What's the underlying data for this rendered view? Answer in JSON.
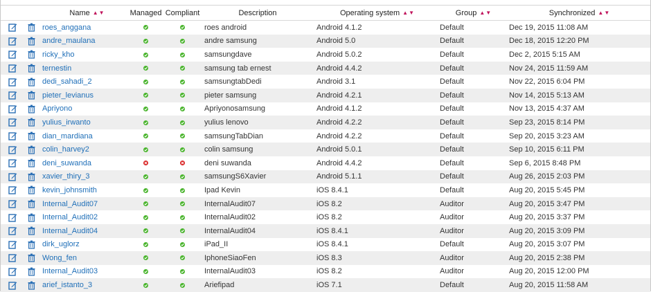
{
  "columns": {
    "name": "Name",
    "managed": "Managed",
    "compliant": "Compliant",
    "description": "Description",
    "os": "Operating system",
    "group": "Group",
    "synchronized": "Synchronized"
  },
  "sort_indicator": "▲▼",
  "colors": {
    "link": "#1f6fb8",
    "sort_arrow": "#c0135b",
    "ok": "#49b42c",
    "bad": "#d92525",
    "icon_blue": "#2a6fb5"
  },
  "icons": {
    "edit": "edit-icon",
    "delete": "trash-icon",
    "ok": "check-circle-icon",
    "bad": "x-circle-icon"
  },
  "rows": [
    {
      "name": "roes_anggana",
      "managed": "ok",
      "compliant": "ok",
      "description": "roes android",
      "os": "Android 4.1.2",
      "group": "Default",
      "synchronized": "Dec 19, 2015 11:08 AM"
    },
    {
      "name": "andre_maulana",
      "managed": "ok",
      "compliant": "ok",
      "description": "andre samsung",
      "os": "Android 5.0",
      "group": "Default",
      "synchronized": "Dec 18, 2015 12:20 PM"
    },
    {
      "name": "ricky_kho",
      "managed": "ok",
      "compliant": "ok",
      "description": "samsungdave",
      "os": "Android 5.0.2",
      "group": "Default",
      "synchronized": "Dec 2, 2015 5:15 AM"
    },
    {
      "name": "ternestin",
      "managed": "ok",
      "compliant": "ok",
      "description": "samsung tab ernest",
      "os": "Android 4.4.2",
      "group": "Default",
      "synchronized": "Nov 24, 2015 11:59 AM"
    },
    {
      "name": "dedi_sahadi_2",
      "managed": "ok",
      "compliant": "ok",
      "description": "samsungtabDedi",
      "os": "Android 3.1",
      "group": "Default",
      "synchronized": "Nov 22, 2015 6:04 PM"
    },
    {
      "name": "pieter_levianus",
      "managed": "ok",
      "compliant": "ok",
      "description": "pieter samsung",
      "os": "Android 4.2.1",
      "group": "Default",
      "synchronized": "Nov 14, 2015 5:13 AM"
    },
    {
      "name": "Apriyono",
      "managed": "ok",
      "compliant": "ok",
      "description": "Apriyonosamsung",
      "os": "Android 4.1.2",
      "group": "Default",
      "synchronized": "Nov 13, 2015 4:37 AM"
    },
    {
      "name": "yulius_irwanto",
      "managed": "ok",
      "compliant": "ok",
      "description": "yulius lenovo",
      "os": "Android 4.2.2",
      "group": "Default",
      "synchronized": "Sep 23, 2015 8:14 PM"
    },
    {
      "name": "dian_mardiana",
      "managed": "ok",
      "compliant": "ok",
      "description": "samsungTabDian",
      "os": "Android 4.2.2",
      "group": "Default",
      "synchronized": "Sep 20, 2015 3:23 AM"
    },
    {
      "name": "colin_harvey2",
      "managed": "ok",
      "compliant": "ok",
      "description": "colin samsung",
      "os": "Android 5.0.1",
      "group": "Default",
      "synchronized": "Sep 10, 2015 6:11 PM"
    },
    {
      "name": "deni_suwanda",
      "managed": "bad",
      "compliant": "bad",
      "description": "deni suwanda",
      "os": "Android 4.4.2",
      "group": "Default",
      "synchronized": "Sep 6, 2015 8:48 PM"
    },
    {
      "name": "xavier_thiry_3",
      "managed": "ok",
      "compliant": "ok",
      "description": "samsungS6Xavier",
      "os": "Android 5.1.1",
      "group": "Default",
      "synchronized": "Aug 26, 2015 2:03 PM"
    },
    {
      "name": "kevin_johnsmith",
      "managed": "ok",
      "compliant": "ok",
      "description": "Ipad Kevin",
      "os": "iOS 8.4.1",
      "group": "Default",
      "synchronized": "Aug 20, 2015 5:45 PM"
    },
    {
      "name": "Internal_Audit07",
      "managed": "ok",
      "compliant": "ok",
      "description": "InternalAudit07",
      "os": "iOS 8.2",
      "group": "Auditor",
      "synchronized": "Aug 20, 2015 3:47 PM"
    },
    {
      "name": "Internal_Audit02",
      "managed": "ok",
      "compliant": "ok",
      "description": "InternalAudit02",
      "os": "iOS 8.2",
      "group": "Auditor",
      "synchronized": "Aug 20, 2015 3:37 PM"
    },
    {
      "name": "Internal_Audit04",
      "managed": "ok",
      "compliant": "ok",
      "description": "InternalAudit04",
      "os": "iOS 8.4.1",
      "group": "Auditor",
      "synchronized": "Aug 20, 2015 3:09 PM"
    },
    {
      "name": "dirk_uglorz",
      "managed": "ok",
      "compliant": "ok",
      "description": "iPad_II",
      "os": "iOS 8.4.1",
      "group": "Default",
      "synchronized": "Aug 20, 2015 3:07 PM"
    },
    {
      "name": "Wong_fen",
      "managed": "ok",
      "compliant": "ok",
      "description": "IphoneSiaoFen",
      "os": "iOS 8.3",
      "group": "Auditor",
      "synchronized": "Aug 20, 2015 2:38 PM"
    },
    {
      "name": "Internal_Audit03",
      "managed": "ok",
      "compliant": "ok",
      "description": "InternalAudit03",
      "os": "iOS 8.2",
      "group": "Auditor",
      "synchronized": "Aug 20, 2015 12:00 PM"
    },
    {
      "name": "arief_istanto_3",
      "managed": "ok",
      "compliant": "ok",
      "description": "Ariefipad",
      "os": "iOS 7.1",
      "group": "Default",
      "synchronized": "Aug 20, 2015 11:58 AM"
    }
  ]
}
